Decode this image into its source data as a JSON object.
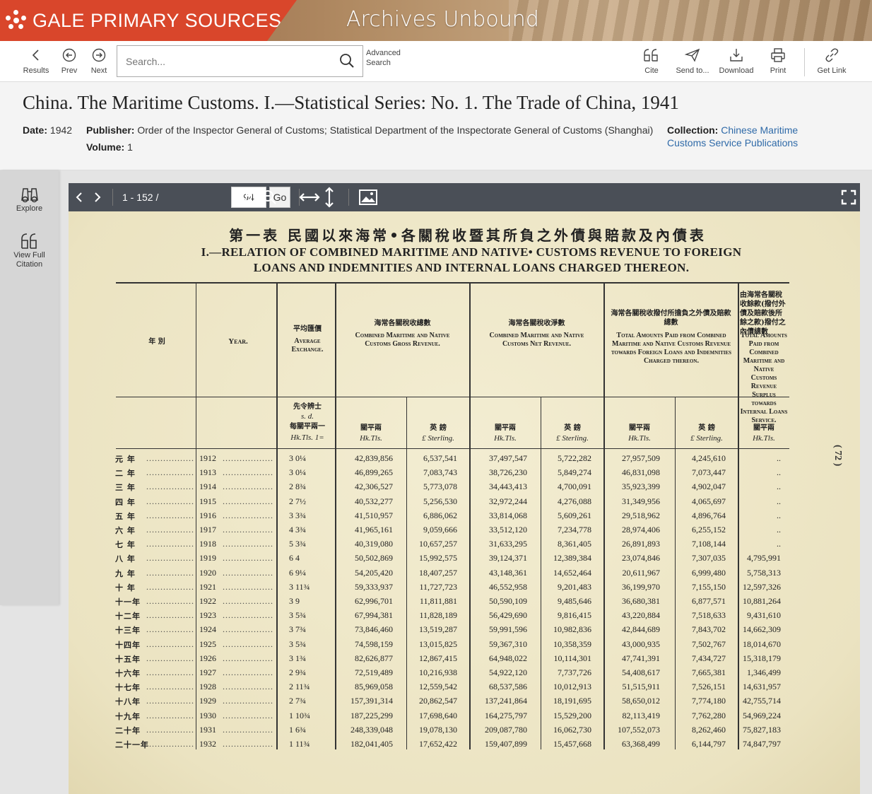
{
  "banner": {
    "brand": "GALE PRIMARY SOURCES",
    "product": "Archives Unbound",
    "brand_color": "#d9462b"
  },
  "toolbar": {
    "results": "Results",
    "prev": "Prev",
    "next": "Next",
    "search_placeholder": "Search...",
    "advanced_search_1": "Advanced",
    "advanced_search_2": "Search",
    "cite": "Cite",
    "send_to": "Send to...",
    "download": "Download",
    "print": "Print",
    "get_link": "Get Link"
  },
  "citation": {
    "title": "China. The Maritime Customs. I.—Statistical Series: No. 1. The Trade of China, 1941",
    "date_label": "Date:",
    "date": "1942",
    "publisher_label": "Publisher:",
    "publisher": "Order of the Inspector General of Customs; Statistical Department of the Inspectorate General of Customs (Shanghai)",
    "volume_label": "Volume:",
    "volume": "1",
    "collection_label": "Collection:",
    "collection_1": "Chinese Maritime",
    "collection_2": "Customs Service Publications",
    "link_color": "#2f6aa8"
  },
  "leftrail": {
    "explore": "Explore",
    "view_full_1": "View Full",
    "view_full_2": "Citation"
  },
  "viewer": {
    "page_range": "1 - 152 /",
    "page_value": "94",
    "go": "Go"
  },
  "scan": {
    "title_cn": "第一表 民國以來海常•各關稅收暨其所負之外債與賠款及內債表",
    "title_en_1": "I.—RELATION OF COMBINED MARITIME AND NATIVE• CUSTOMS REVENUE TO FOREIGN",
    "title_en_2": "LOANS AND INDEMNITIES AND INTERNAL LOANS CHARGED THEREON.",
    "col_cn_year": "年 別",
    "col_year": "Year.",
    "col_exchange_cn": "平均匯價",
    "col_exchange": "Average Exchange.",
    "col_gross_cn": "海常各關稅收總數",
    "col_gross": "Combined Maritime and Native Customs Gross Revenue.",
    "col_net_cn": "海常各關稅收淨數",
    "col_net": "Combined Maritime and Native Customs Net Revenue.",
    "col_paid_cn": "海常各關稅收撥付所擔負之外債及賠款總數",
    "col_paid": "Total Amounts Paid from Combined Maritime and Native Customs Revenue towards Foreign Loans and Indemnities Charged thereon.",
    "col_surplus_cn": "由海常各關稅收餘款(撥付外債及賠款後所餘之款)撥付之內債總數",
    "col_surplus": "Total Amounts Paid from Combined Maritime and Native Customs Revenue Surplus towards Internal Loans Service.",
    "ex_unit_cn": "先令辨士",
    "ex_unit_sd": "s. d.",
    "ex_unit_hk_cn": "每關平兩一",
    "ex_unit": "Hk.Tls. 1=",
    "unit_hk_cn": "關平兩",
    "unit_hk": "Hk.Tls.",
    "unit_st_cn": "英 鎊",
    "unit_st": "£ Sterling.",
    "side_page": "( 72 )"
  },
  "rows": [
    {
      "cn": "元 年",
      "yr": "1912",
      "ex": "3  0¼",
      "g1": "42,839,856",
      "g2": "6,537,541",
      "n1": "37,497,547",
      "n2": "5,722,282",
      "p1": "27,957,509",
      "p2": "4,245,610",
      "s": ".."
    },
    {
      "cn": "二 年",
      "yr": "1913",
      "ex": "3  0¼",
      "g1": "46,899,265",
      "g2": "7,083,743",
      "n1": "38,726,230",
      "n2": "5,849,274",
      "p1": "46,831,098",
      "p2": "7,073,447",
      "s": ".."
    },
    {
      "cn": "三 年",
      "yr": "1914",
      "ex": "2  8¾",
      "g1": "42,306,527",
      "g2": "5,773,078",
      "n1": "34,443,413",
      "n2": "4,700,091",
      "p1": "35,923,399",
      "p2": "4,902,047",
      "s": ".."
    },
    {
      "cn": "四 年",
      "yr": "1915",
      "ex": "2  7½",
      "g1": "40,532,277",
      "g2": "5,256,530",
      "n1": "32,972,244",
      "n2": "4,276,088",
      "p1": "31,349,956",
      "p2": "4,065,697",
      "s": ".."
    },
    {
      "cn": "五 年",
      "yr": "1916",
      "ex": "3  3¾",
      "g1": "41,510,957",
      "g2": "6,886,062",
      "n1": "33,814,068",
      "n2": "5,609,261",
      "p1": "29,518,962",
      "p2": "4,896,764",
      "s": ".."
    },
    {
      "cn": "六 年",
      "yr": "1917",
      "ex": "4  3¾",
      "g1": "41,965,161",
      "g2": "9,059,666",
      "n1": "33,512,120",
      "n2": "7,234,778",
      "p1": "28,974,406",
      "p2": "6,255,152",
      "s": ".."
    },
    {
      "cn": "七 年",
      "yr": "1918",
      "ex": "5  3¾",
      "g1": "40,319,080",
      "g2": "10,657,257",
      "n1": "31,633,295",
      "n2": "8,361,405",
      "p1": "26,891,893",
      "p2": "7,108,144",
      "s": ".."
    },
    {
      "cn": "八 年",
      "yr": "1919",
      "ex": "6  4",
      "g1": "50,502,869",
      "g2": "15,992,575",
      "n1": "39,124,371",
      "n2": "12,389,384",
      "p1": "23,074,846",
      "p2": "7,307,035",
      "s": "4,795,991"
    },
    {
      "cn": "九 年",
      "yr": "1920",
      "ex": "6  9¼",
      "g1": "54,205,420",
      "g2": "18,407,257",
      "n1": "43,148,361",
      "n2": "14,652,464",
      "p1": "20,611,967",
      "p2": "6,999,480",
      "s": "5,758,313"
    },
    {
      "cn": "十 年",
      "yr": "1921",
      "ex": "3  11¾",
      "g1": "59,333,937",
      "g2": "11,727,723",
      "n1": "46,552,958",
      "n2": "9,201,483",
      "p1": "36,199,970",
      "p2": "7,155,150",
      "s": "12,597,326"
    },
    {
      "cn": "十一年",
      "yr": "1922",
      "ex": "3  9",
      "g1": "62,996,701",
      "g2": "11,811,881",
      "n1": "50,590,109",
      "n2": "9,485,646",
      "p1": "36,680,381",
      "p2": "6,877,571",
      "s": "10,881,264"
    },
    {
      "cn": "十二年",
      "yr": "1923",
      "ex": "3  5¾",
      "g1": "67,994,381",
      "g2": "11,828,189",
      "n1": "56,429,690",
      "n2": "9,816,415",
      "p1": "43,220,884",
      "p2": "7,518,633",
      "s": "9,431,610"
    },
    {
      "cn": "十三年",
      "yr": "1924",
      "ex": "3  7¾",
      "g1": "73,846,460",
      "g2": "13,519,287",
      "n1": "59,991,596",
      "n2": "10,982,836",
      "p1": "42,844,689",
      "p2": "7,843,702",
      "s": "14,662,309"
    },
    {
      "cn": "十四年",
      "yr": "1925",
      "ex": "3  5¾",
      "g1": "74,598,159",
      "g2": "13,015,825",
      "n1": "59,367,310",
      "n2": "10,358,359",
      "p1": "43,000,935",
      "p2": "7,502,767",
      "s": "18,014,670"
    },
    {
      "cn": "十五年",
      "yr": "1926",
      "ex": "3  1¾",
      "g1": "82,626,877",
      "g2": "12,867,415",
      "n1": "64,948,022",
      "n2": "10,114,301",
      "p1": "47,741,391",
      "p2": "7,434,727",
      "s": "15,318,179"
    },
    {
      "cn": "十六年",
      "yr": "1927",
      "ex": "2  9¾",
      "g1": "72,519,489",
      "g2": "10,216,938",
      "n1": "54,922,120",
      "n2": "7,737,726",
      "p1": "54,408,617",
      "p2": "7,665,381",
      "s": "1,346,499"
    },
    {
      "cn": "十七年",
      "yr": "1928",
      "ex": "2  11¾",
      "g1": "85,969,058",
      "g2": "12,559,542",
      "n1": "68,537,586",
      "n2": "10,012,913",
      "p1": "51,515,911",
      "p2": "7,526,151",
      "s": "14,631,957"
    },
    {
      "cn": "十八年",
      "yr": "1929",
      "ex": "2  7¾",
      "g1": "157,391,314",
      "g2": "20,862,547",
      "n1": "137,241,864",
      "n2": "18,191,695",
      "p1": "58,650,012",
      "p2": "7,774,180",
      "s": "42,755,714"
    },
    {
      "cn": "十九年",
      "yr": "1930",
      "ex": "1  10¾",
      "g1": "187,225,299",
      "g2": "17,698,640",
      "n1": "164,275,797",
      "n2": "15,529,200",
      "p1": "82,113,419",
      "p2": "7,762,280",
      "s": "54,969,224"
    },
    {
      "cn": "二十年",
      "yr": "1931",
      "ex": "1  6¾",
      "g1": "248,339,048",
      "g2": "19,078,130",
      "n1": "209,087,780",
      "n2": "16,062,730",
      "p1": "107,552,073",
      "p2": "8,262,460",
      "s": "75,827,183"
    },
    {
      "cn": "二十一年",
      "yr": "1932",
      "ex": "1  11¾",
      "g1": "182,041,405",
      "g2": "17,652,422",
      "n1": "159,407,899",
      "n2": "15,457,668",
      "p1": "63,368,499",
      "p2": "6,144,797",
      "s": "74,847,797"
    }
  ]
}
